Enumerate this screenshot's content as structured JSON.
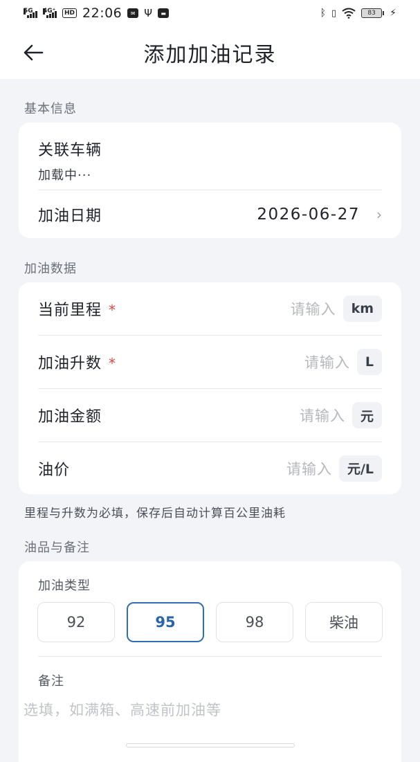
{
  "statusbar": {
    "net1": "5G",
    "net2": "4G⁺",
    "hd": "HD",
    "time": "22:06",
    "battery": "83"
  },
  "header": {
    "title": "添加加油记录"
  },
  "basic": {
    "section_label": "基本信息",
    "vehicle_label": "关联车辆",
    "vehicle_value": "加载中···",
    "date_label": "加油日期",
    "date_value": "2026-06-27"
  },
  "fuel_data": {
    "section_label": "加油数据",
    "rows": [
      {
        "label": "当前里程",
        "required": "*",
        "placeholder": "请输入",
        "unit": "km"
      },
      {
        "label": "加油升数",
        "required": "*",
        "placeholder": "请输入",
        "unit": "L"
      },
      {
        "label": "加油金额",
        "required": "",
        "placeholder": "请输入",
        "unit": "元"
      },
      {
        "label": "油价",
        "required": "",
        "placeholder": "请输入",
        "unit": "元/L"
      }
    ],
    "hint": "里程与升数为必填，保存后自动计算百公里油耗"
  },
  "fuel_type": {
    "section_label": "油品与备注",
    "type_label": "加油类型",
    "options": [
      "92",
      "95",
      "98",
      "柴油"
    ],
    "selected": "95",
    "note_label": "备注",
    "note_placeholder": "选填，如满箱、高速前加油等"
  },
  "colors": {
    "accent": "#2f6eb5",
    "required": "#e0443e",
    "background": "#f3f4f8"
  }
}
